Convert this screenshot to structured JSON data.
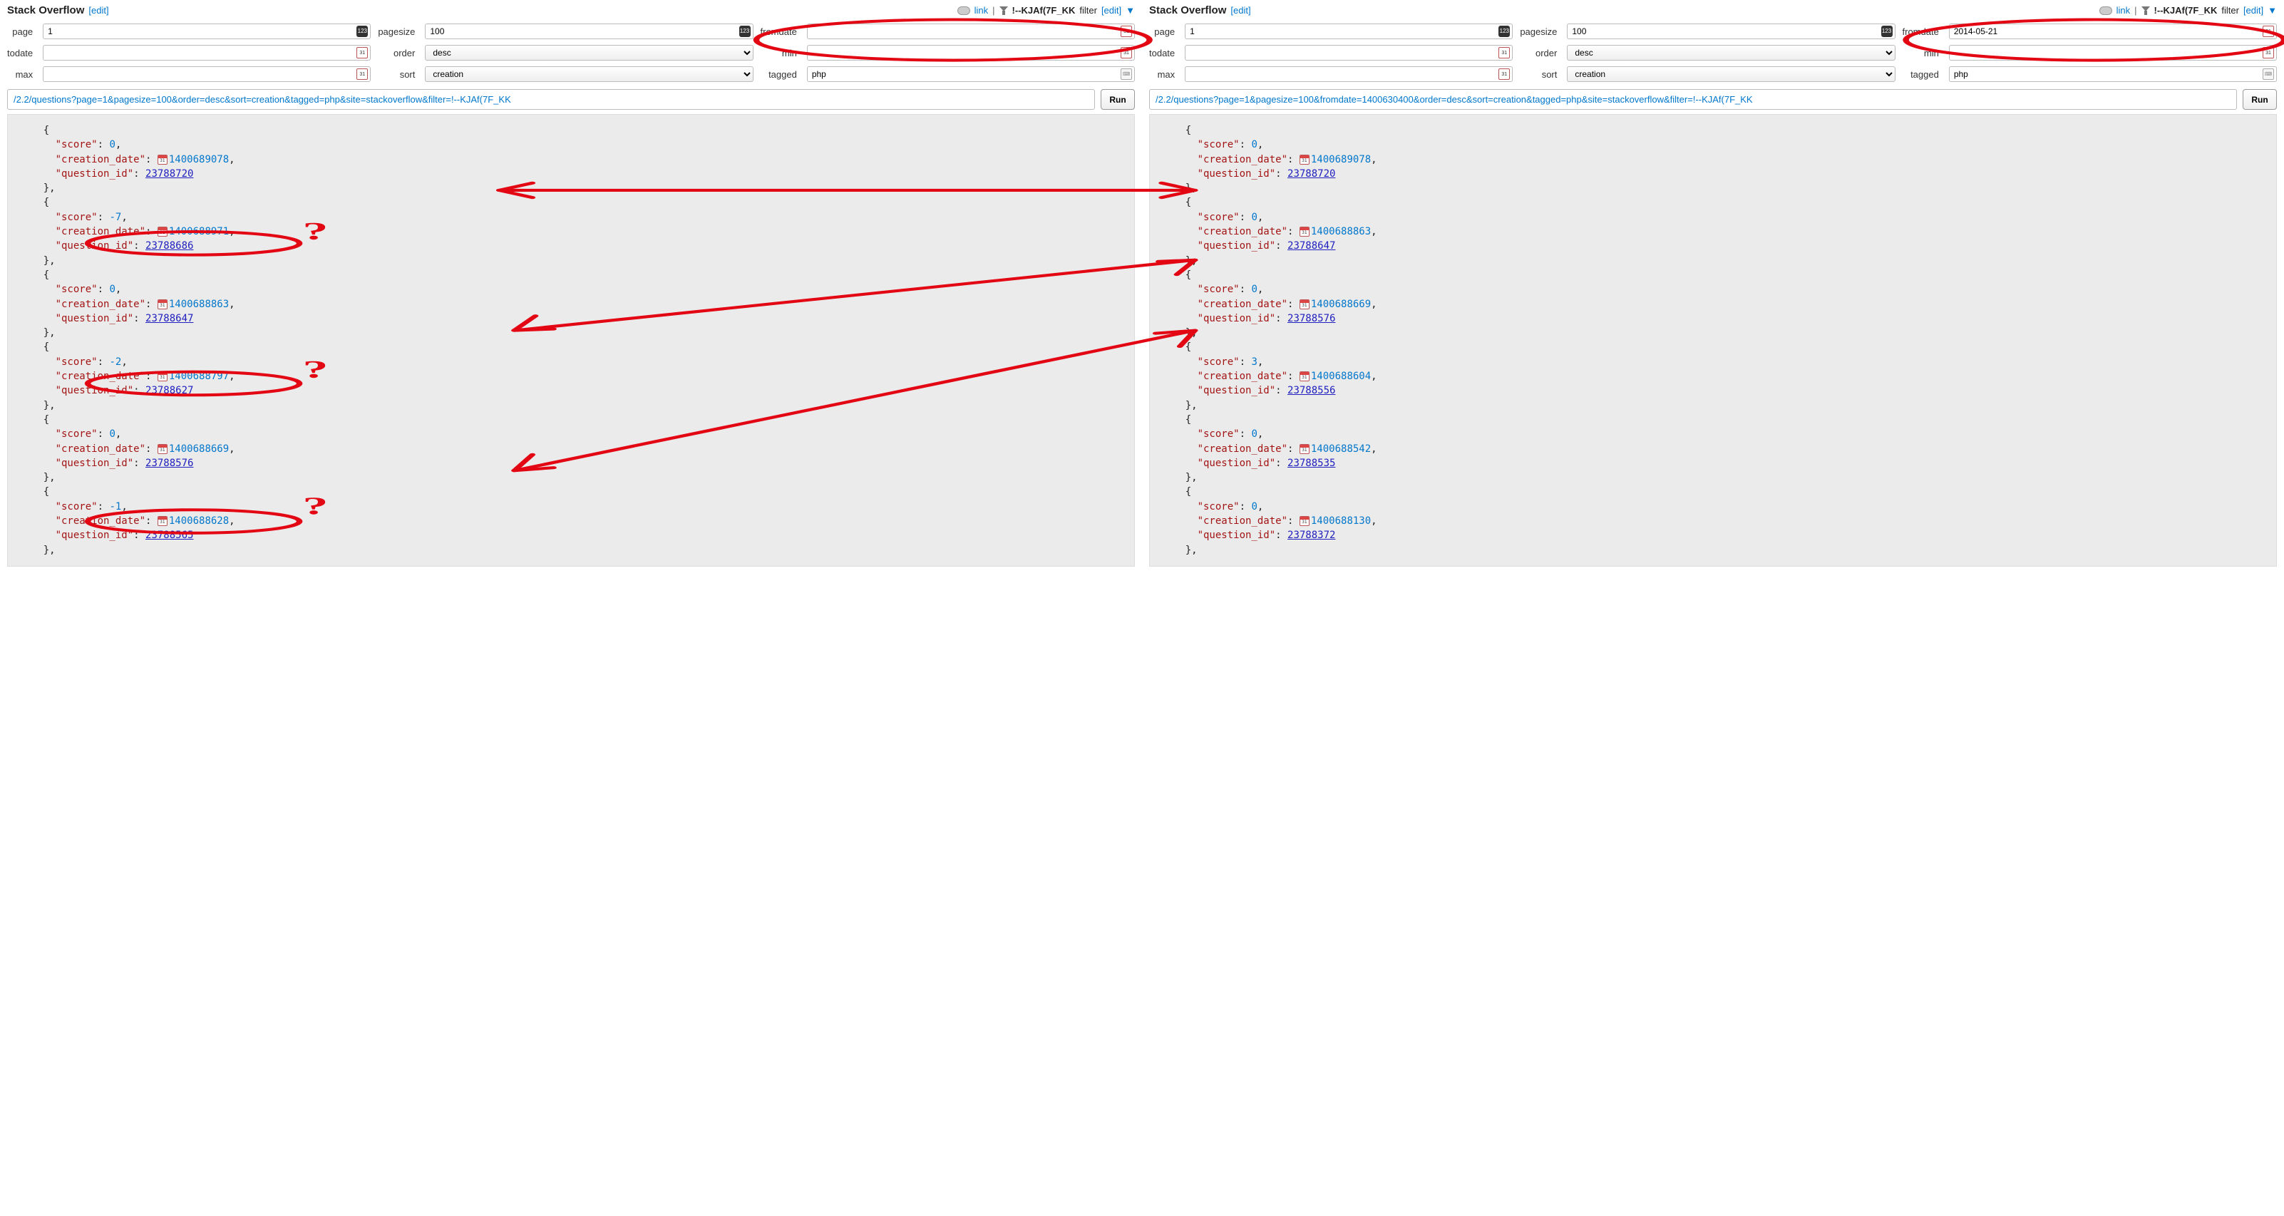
{
  "header": {
    "title": "Stack Overflow",
    "edit": "[edit]",
    "link": "link",
    "filter_text": "!--KJAf(7F_KK",
    "filter_word": "filter",
    "filter_edit": "[edit]"
  },
  "labels": {
    "page": "page",
    "pagesize": "pagesize",
    "fromdate": "fromdate",
    "todate": "todate",
    "order": "order",
    "min": "min",
    "max": "max",
    "sort": "sort",
    "tagged": "tagged"
  },
  "left": {
    "page": "1",
    "pagesize": "100",
    "fromdate": "",
    "todate": "",
    "order": "desc",
    "min": "",
    "max": "",
    "sort": "creation",
    "tagged": "php",
    "url": "/2.2/questions?page=1&pagesize=100&order=desc&sort=creation&tagged=php&site=stackoverflow&filter=!--KJAf(7F_KK",
    "results": [
      {
        "score": 0,
        "creation_date": 1400689078,
        "question_id": 23788720
      },
      {
        "score": -7,
        "creation_date": 1400688971,
        "question_id": 23788686
      },
      {
        "score": 0,
        "creation_date": 1400688863,
        "question_id": 23788647
      },
      {
        "score": -2,
        "creation_date": 1400688797,
        "question_id": 23788627
      },
      {
        "score": 0,
        "creation_date": 1400688669,
        "question_id": 23788576
      },
      {
        "score": -1,
        "creation_date": 1400688628,
        "question_id": 23788565
      }
    ]
  },
  "right": {
    "page": "1",
    "pagesize": "100",
    "fromdate": "2014-05-21",
    "todate": "",
    "order": "desc",
    "min": "",
    "max": "",
    "sort": "creation",
    "tagged": "php",
    "url": "/2.2/questions?page=1&pagesize=100&fromdate=1400630400&order=desc&sort=creation&tagged=php&site=stackoverflow&filter=!--KJAf(7F_KK",
    "results": [
      {
        "score": 0,
        "creation_date": 1400689078,
        "question_id": 23788720
      },
      {
        "score": 0,
        "creation_date": 1400688863,
        "question_id": 23788647
      },
      {
        "score": 0,
        "creation_date": 1400688669,
        "question_id": 23788576
      },
      {
        "score": 3,
        "creation_date": 1400688604,
        "question_id": 23788556
      },
      {
        "score": 0,
        "creation_date": 1400688542,
        "question_id": 23788535
      },
      {
        "score": 0,
        "creation_date": 1400688130,
        "question_id": 23788372
      }
    ]
  },
  "run": "Run"
}
